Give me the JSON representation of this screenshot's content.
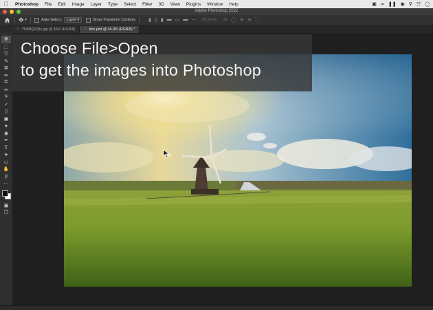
{
  "menubar": {
    "app_name": "Photoshop",
    "items": [
      "File",
      "Edit",
      "Image",
      "Layer",
      "Type",
      "Select",
      "Filter",
      "3D",
      "View",
      "Plugins",
      "Window",
      "Help"
    ]
  },
  "window": {
    "title": "Adobe Photoshop 2022"
  },
  "options": {
    "auto_select_label": "Auto-Select:",
    "auto_select_value": "Layer",
    "transform_label": "Show Transform Controls",
    "mode_3d_label": "3D Mode:"
  },
  "tabs": [
    {
      "label": "YN6BQ1ZjIs.jpg @ 46% (RGB/8)",
      "active": false
    },
    {
      "label": "tlon.psd @ 46.4% (RGB/8) *",
      "active": true
    }
  ],
  "overlay": {
    "line1": "Choose File>Open",
    "line2": "to get the images into Photoshop"
  },
  "colors": {
    "foreground": "#111111",
    "background": "#ffffff"
  },
  "icons": {
    "tools": [
      "move-icon",
      "marquee-icon",
      "lasso-icon",
      "quick-select-icon",
      "crop-icon",
      "eyedropper-icon",
      "healing-icon",
      "brush-icon",
      "stamp-icon",
      "history-brush-icon",
      "eraser-icon",
      "gradient-icon",
      "blur-icon",
      "dodge-icon",
      "pen-icon",
      "type-icon",
      "path-select-icon",
      "shape-icon",
      "hand-icon",
      "zoom-icon"
    ]
  }
}
